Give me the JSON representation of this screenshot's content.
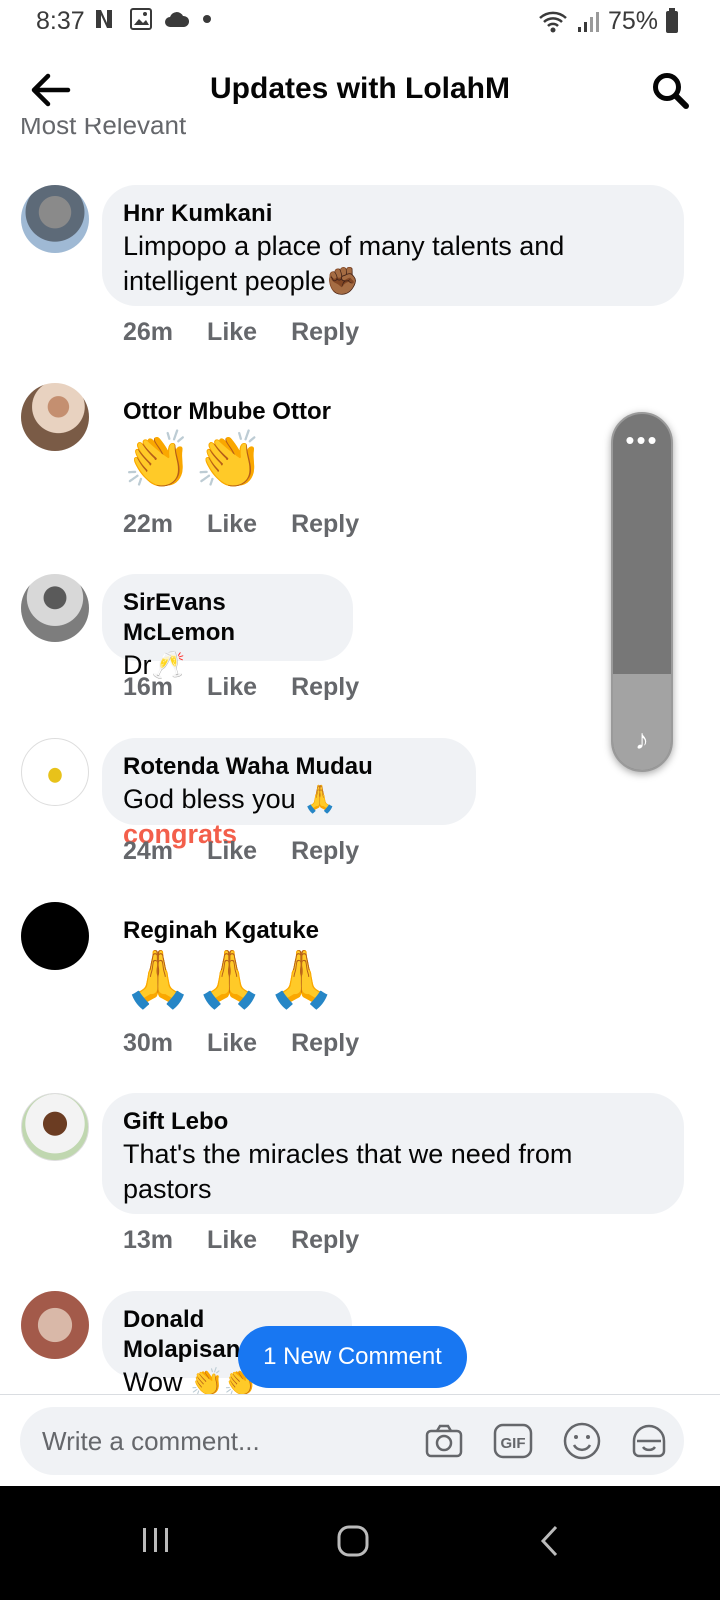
{
  "status_bar": {
    "time": "8:37",
    "battery": "75%"
  },
  "header": {
    "title": "Updates with LolahM"
  },
  "sort_label": "Most Relevant",
  "comments": [
    {
      "author": "Hnr Kumkani",
      "text": "Limpopo a place of many talents and",
      "text2": "intelligent people✊🏾",
      "age": "26m",
      "like": "Like",
      "reply": "Reply"
    },
    {
      "author": "Ottor Mbube Ottor",
      "text": "👏👏",
      "age": "22m",
      "like": "Like",
      "reply": "Reply"
    },
    {
      "author": "SirEvans McLemon",
      "text": "Dr🥂",
      "age": "16m",
      "like": "Like",
      "reply": "Reply"
    },
    {
      "author": "Rotenda Waha Mudau",
      "text": "God bless you 🙏 ",
      "highlight": "congrats",
      "age": "24m",
      "like": "Like",
      "reply": "Reply"
    },
    {
      "author": "Reginah Kgatuke",
      "text": "🙏🙏🙏",
      "age": "30m",
      "like": "Like",
      "reply": "Reply"
    },
    {
      "author": "Gift Lebo",
      "text": "That's the miracles that we need from",
      "text2": "pastors",
      "age": "13m",
      "like": "Like",
      "reply": "Reply"
    },
    {
      "author": "Donald Molapisane",
      "text": "Wow 👏👏"
    }
  ],
  "new_comment_pill": "1 New Comment",
  "composer": {
    "placeholder": "Write a comment..."
  },
  "colors": {
    "accent": "#1877f2",
    "highlight": "#f35f4b",
    "bubble": "#f0f2f5"
  }
}
